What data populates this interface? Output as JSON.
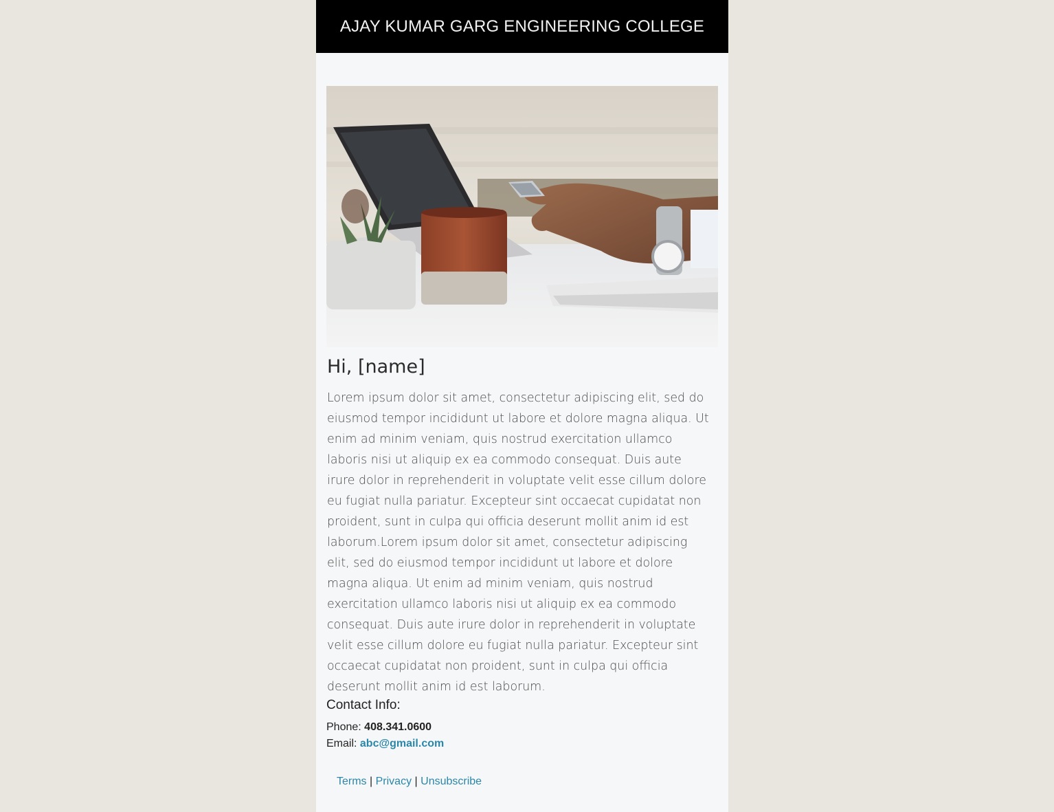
{
  "header": {
    "title": "AJAY KUMAR GARG ENGINEERING COLLEGE"
  },
  "hero_image": {
    "alt": "Person using a phone at a desk with a laptop, coffee cup and plant"
  },
  "greeting": "Hi, [name]",
  "body": "Lorem ipsum dolor sit amet, consectetur adipiscing elit, sed do eiusmod tempor incididunt ut labore et dolore magna aliqua. Ut enim ad minim veniam, quis nostrud exercitation ullamco laboris nisi ut aliquip ex ea commodo consequat. Duis aute irure dolor in reprehenderit in voluptate velit esse cillum dolore eu fugiat nulla pariatur. Excepteur sint occaecat cupidatat non proident, sunt in culpa qui officia deserunt mollit anim id est laborum.Lorem ipsum dolor sit amet, consectetur adipiscing elit, sed do eiusmod tempor incididunt ut labore et dolore magna aliqua. Ut enim ad minim veniam, quis nostrud exercitation ullamco laboris nisi ut aliquip ex ea commodo consequat. Duis aute irure dolor in reprehenderit in voluptate velit esse cillum dolore eu fugiat nulla pariatur. Excepteur sint occaecat cupidatat non proident, sunt in culpa qui officia deserunt mollit anim id est laborum.",
  "contact": {
    "heading": "Contact Info:",
    "phone_label": "Phone:",
    "phone_value": "408.341.0600",
    "email_label": "Email:",
    "email_value": "abc@gmail.com"
  },
  "footer": {
    "links": [
      "Terms",
      "Privacy",
      "Unsubscribe"
    ],
    "separator": "|"
  },
  "colors": {
    "page_background": "#e9e6df",
    "email_background": "#f6f7f9",
    "header_background": "#000000",
    "link": "#2b86a8"
  }
}
